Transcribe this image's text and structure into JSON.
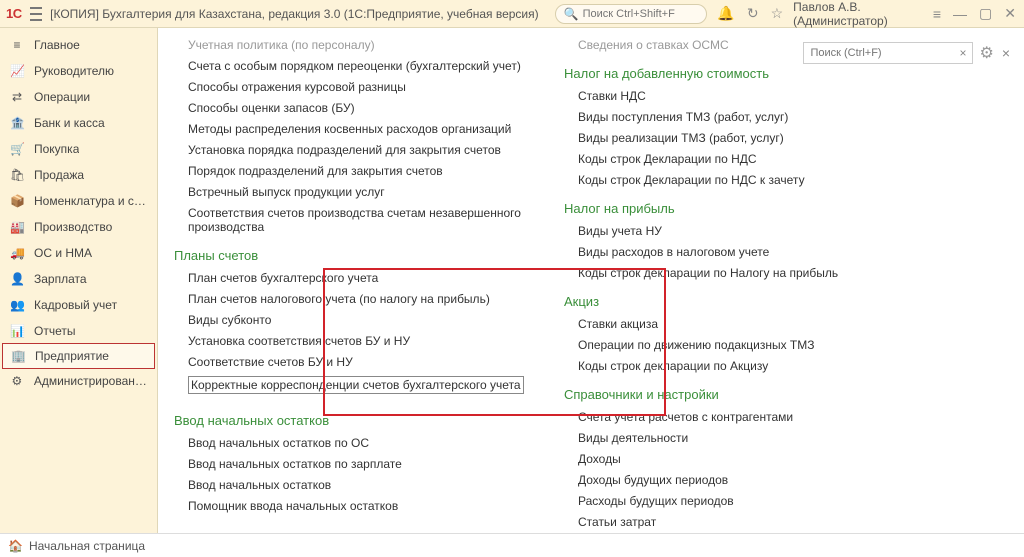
{
  "topbar": {
    "logo": "1С",
    "title": "[КОПИЯ] Бухгалтерия для Казахстана, редакция 3.0  (1С:Предприятие, учебная версия)",
    "search_placeholder": "Поиск Ctrl+Shift+F",
    "user": "Павлов А.В. (Администратор)"
  },
  "sidebar": {
    "items": [
      {
        "icon": "≡",
        "label": "Главное"
      },
      {
        "icon": "📈",
        "label": "Руководителю"
      },
      {
        "icon": "⇄",
        "label": "Операции"
      },
      {
        "icon": "🏦",
        "label": "Банк и касса"
      },
      {
        "icon": "🛒",
        "label": "Покупка"
      },
      {
        "icon": "🛍",
        "label": "Продажа"
      },
      {
        "icon": "📦",
        "label": "Номенклатура и склад"
      },
      {
        "icon": "🏭",
        "label": "Производство"
      },
      {
        "icon": "🚚",
        "label": "ОС и НМА"
      },
      {
        "icon": "👤",
        "label": "Зарплата"
      },
      {
        "icon": "👥",
        "label": "Кадровый учет"
      },
      {
        "icon": "📊",
        "label": "Отчеты"
      },
      {
        "icon": "🏢",
        "label": "Предприятие"
      },
      {
        "icon": "⚙",
        "label": "Администрирование"
      }
    ]
  },
  "content": {
    "search_placeholder": "Поиск (Ctrl+F)",
    "left_col": {
      "top_links": [
        "Учетная политика (по персоналу)",
        "Счета с особым порядком переоценки (бухгалтерский учет)",
        "Способы отражения курсовой разницы",
        "Способы оценки запасов (БУ)",
        "Методы распределения косвенных расходов организаций",
        "Установка порядка подразделений для закрытия счетов",
        "Порядок подразделений для закрытия счетов",
        "Встречный выпуск продукции услуг",
        "Соответствия счетов производства счетам незавершенного производства"
      ],
      "sec1_title": "Планы счетов",
      "sec1_links": [
        "План счетов бухгалтерского учета",
        "План счетов налогового учета (по налогу на прибыль)",
        "Виды субконто",
        "Установка соответствия счетов БУ и НУ",
        "Соответствие счетов БУ и НУ",
        "Корректные корреспонденции счетов бухгалтерского учета"
      ],
      "sec2_title": "Ввод начальных остатков",
      "sec2_links": [
        "Ввод начальных остатков по ОС",
        "Ввод начальных остатков по зарплате",
        "Ввод начальных остатков",
        "Помощник ввода начальных остатков"
      ]
    },
    "right_col": {
      "top_links": [
        "Сведения о ставках ОСМС"
      ],
      "secA_title": "Налог на добавленную стоимость",
      "secA_links": [
        "Ставки НДС",
        "Виды поступления ТМЗ (работ, услуг)",
        "Виды реализации ТМЗ (работ, услуг)",
        "Коды строк Декларации по НДС",
        "Коды строк Декларации по НДС к зачету"
      ],
      "secB_title": "Налог на прибыль",
      "secB_links": [
        "Виды учета НУ",
        "Виды расходов в налоговом учете",
        "Коды строк декларации по Налогу на прибыль"
      ],
      "secC_title": "Акциз",
      "secC_links": [
        "Ставки акциза",
        "Операции по движению подакцизных ТМЗ",
        "Коды строк декларации по Акцизу"
      ],
      "secD_title": "Справочники и настройки",
      "secD_links": [
        "Счета учета расчетов с контрагентами",
        "Виды деятельности",
        "Доходы",
        "Доходы будущих периодов",
        "Расходы будущих периодов",
        "Статьи затрат"
      ]
    }
  },
  "footer": {
    "home": "Начальная страница"
  }
}
